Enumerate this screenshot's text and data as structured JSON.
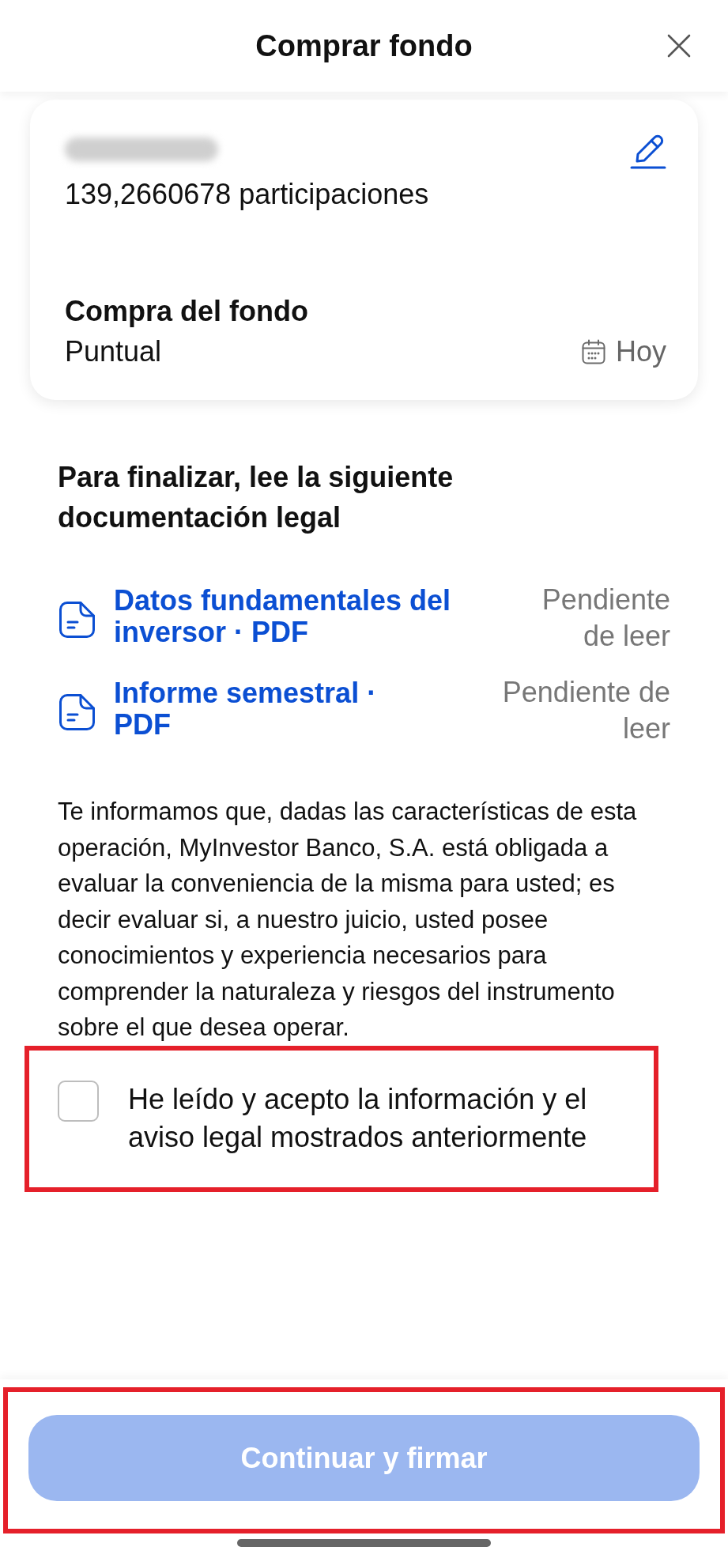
{
  "header": {
    "title": "Comprar fondo"
  },
  "order_card": {
    "units": "139,2660678 participaciones",
    "purchase_label": "Compra del fondo",
    "purchase_type": "Puntual",
    "date": "Hoy"
  },
  "legal_section": {
    "heading": "Para finalizar, lee la siguiente documentación legal",
    "documents": [
      {
        "title": "Datos fundamentales del inversor · PDF",
        "status": "Pendiente de leer"
      },
      {
        "title": "Informe semestral · PDF",
        "status": "Pendiente de leer"
      }
    ],
    "notice": "Te informamos que, dadas las características de esta operación, MyInvestor Banco, S.A. está obligada a evaluar la conveniencia de la misma para usted; es decir evaluar si, a nuestro juicio, usted posee conocimientos y experiencia necesarios para comprender la naturaleza y riesgos del instrumento sobre el que desea operar.",
    "consent": {
      "label": "He leído y acepto la información y el aviso legal mostrados anteriormente",
      "checked": false,
      "highlighted": true
    }
  },
  "footer": {
    "button": {
      "label": "Continuar y firmar",
      "disabled": true,
      "highlighted": true
    }
  }
}
